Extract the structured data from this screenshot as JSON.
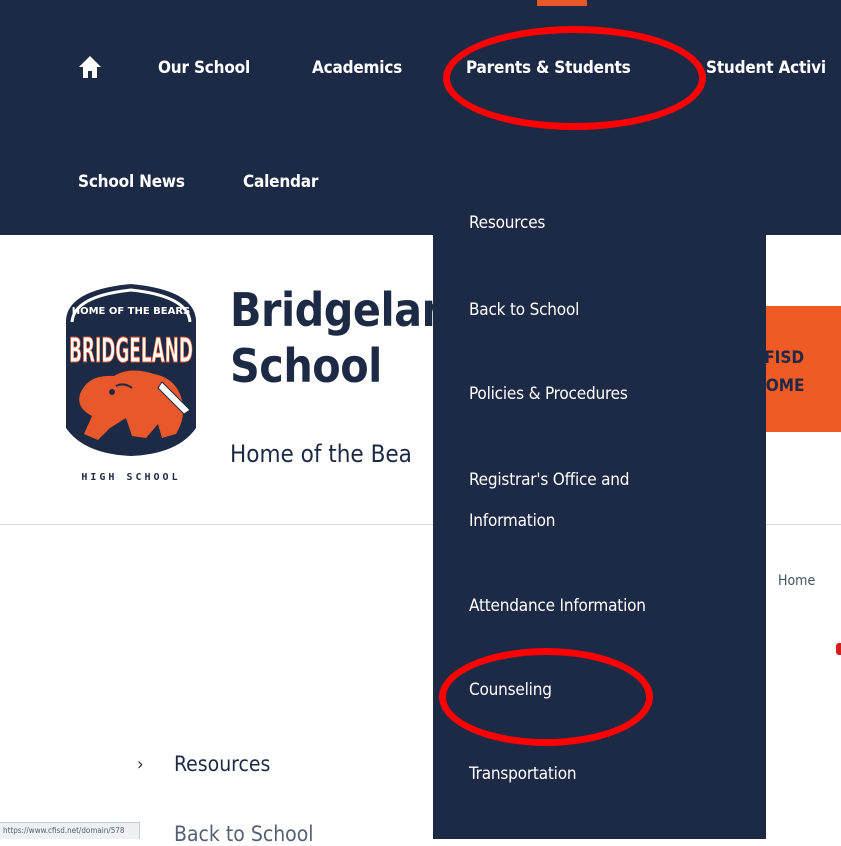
{
  "nav": {
    "items": [
      {
        "label": "Our School"
      },
      {
        "label": "Academics"
      },
      {
        "label": "Parents & Students"
      },
      {
        "label": "Student Activi"
      }
    ],
    "row2": [
      {
        "label": "School News"
      },
      {
        "label": "Calendar"
      }
    ]
  },
  "dropdown": {
    "items": [
      {
        "label": "Resources"
      },
      {
        "label": "Back to School"
      },
      {
        "label": "Policies & Procedures"
      },
      {
        "label": "Registrar's Office and"
      },
      {
        "label": "Information"
      },
      {
        "label": "Attendance Information"
      },
      {
        "label": "Counseling"
      },
      {
        "label": "Transportation"
      }
    ]
  },
  "header": {
    "title_line1": "Bridgelan",
    "title_line2": "School",
    "tagline": "Home of the Bea",
    "cfisd_line1": "CFISD",
    "cfisd_line2": "HOME"
  },
  "logo": {
    "top_text": "HOME OF THE BEARS",
    "name": "BRIDGELAND",
    "bottom_text": "HIGH SCHOOL"
  },
  "breadcrumb": {
    "home": "Home"
  },
  "sidebar": {
    "items": [
      {
        "label": "Resources"
      },
      {
        "label": "Back to School"
      }
    ]
  },
  "status_bar": {
    "url": "https://www.cfisd.net/domain/578"
  },
  "colors": {
    "navy": "#1c2a45",
    "orange": "#f05a24",
    "annotation_red": "#ff0000"
  }
}
